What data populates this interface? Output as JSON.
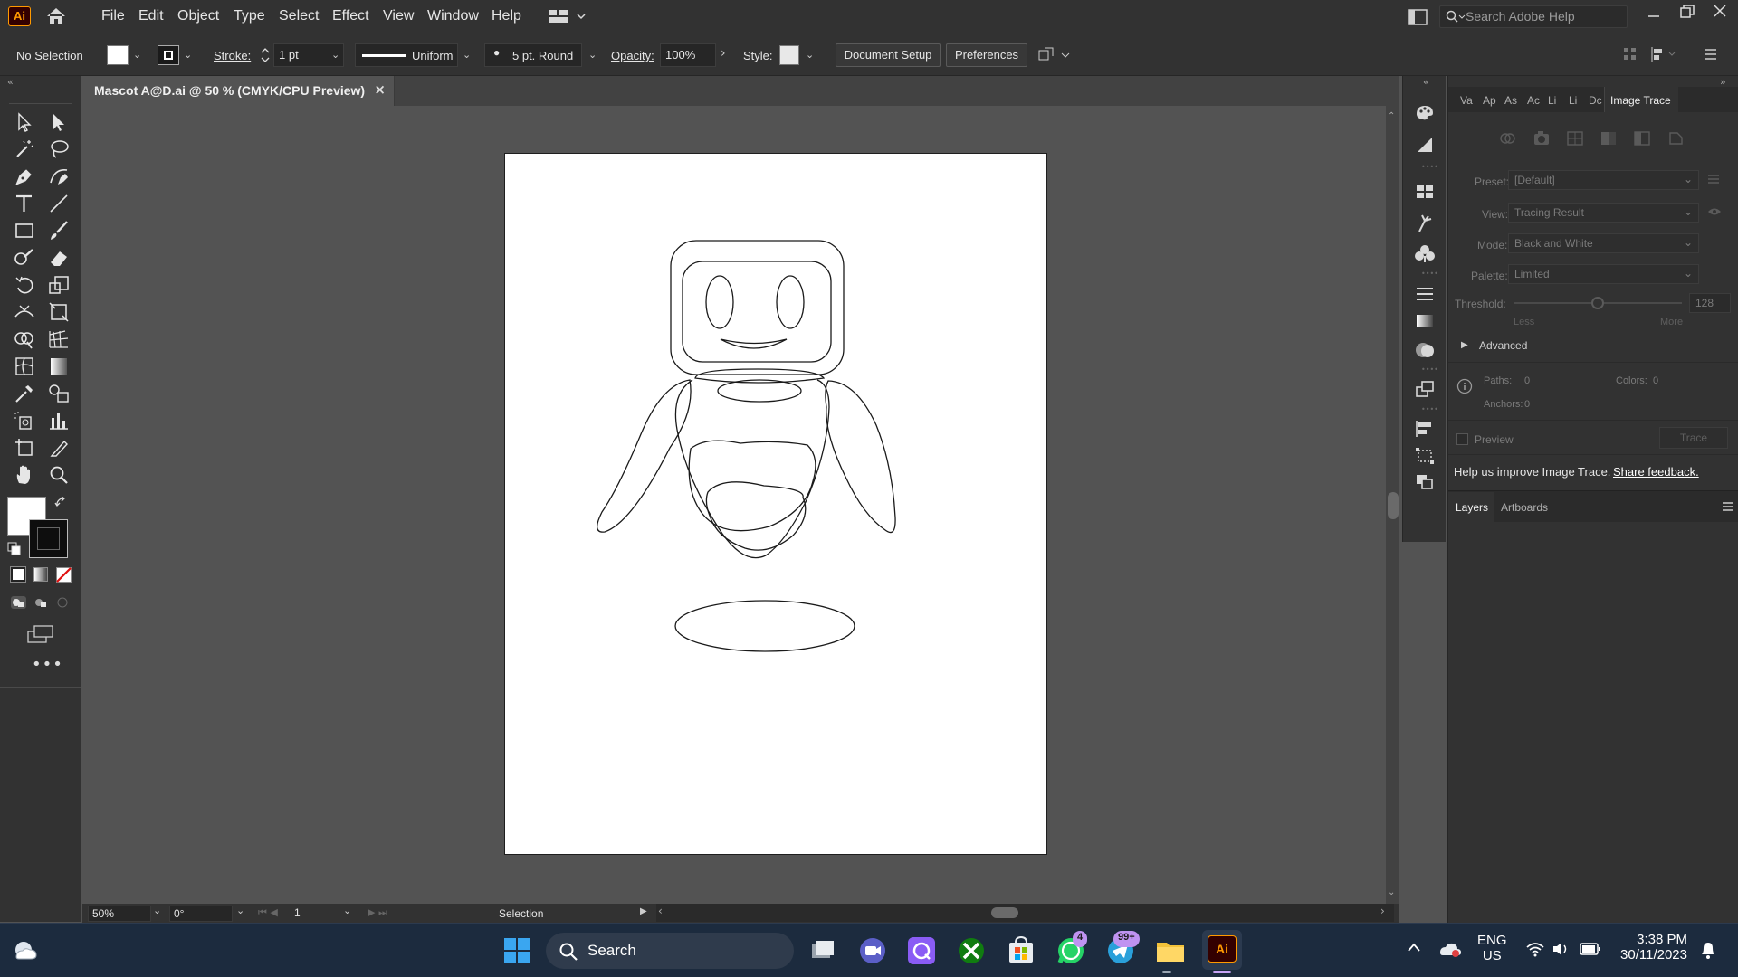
{
  "menubar": {
    "logo": "Ai",
    "items": [
      "File",
      "Edit",
      "Object",
      "Type",
      "Select",
      "Effect",
      "View",
      "Window",
      "Help"
    ],
    "search_placeholder": "Search Adobe Help"
  },
  "control_bar": {
    "selection_status": "No Selection",
    "stroke_label": "Stroke:",
    "stroke_weight": "1 pt",
    "stroke_profile": "Uniform",
    "brush": "5 pt. Round",
    "opacity_label": "Opacity:",
    "opacity_value": "100%",
    "style_label": "Style:",
    "document_setup_label": "Document Setup",
    "preferences_label": "Preferences"
  },
  "document_tab": {
    "title": "Mascot A@D.ai @ 50 % (CMYK/CPU Preview)",
    "close": "×"
  },
  "statusbar": {
    "zoom": "50%",
    "rotation": "0°",
    "artboard_number": "1",
    "current_tool": "Selection"
  },
  "panel": {
    "tabs": [
      "Va",
      "Ap",
      "As",
      "Ac",
      "Li",
      "Li",
      "Dc",
      "Image Trace"
    ],
    "active_tab": "Image Trace",
    "preset_label": "Preset:",
    "preset_value": "[Default]",
    "view_label": "View:",
    "view_value": "Tracing Result",
    "mode_label": "Mode:",
    "mode_value": "Black and White",
    "palette_label": "Palette:",
    "palette_value": "Limited",
    "threshold_label": "Threshold:",
    "threshold_value": "128",
    "threshold_level": 0.5,
    "less_label": "Less",
    "more_label": "More",
    "advanced_label": "Advanced",
    "paths_label": "Paths:",
    "paths_value": "0",
    "colors_label": "Colors:",
    "colors_value": "0",
    "anchors_label": "Anchors:",
    "anchors_value": "0",
    "preview_label": "Preview",
    "trace_label": "Trace",
    "feedback_text": "Help us improve Image Trace.",
    "feedback_link": "Share feedback.",
    "layer_tabs": [
      "Layers",
      "Artboards"
    ]
  },
  "taskbar": {
    "search_label": "Search",
    "whatsapp_badge": "4",
    "telegram_badge": "99+",
    "language_top": "ENG",
    "language_bottom": "US",
    "time": "3:38 PM",
    "date": "30/11/2023"
  },
  "colors": {
    "app_bg": "#535353",
    "panel_bg": "#323232",
    "accent": "#ff9a00",
    "taskbar_bg": "#1c2b3e"
  }
}
